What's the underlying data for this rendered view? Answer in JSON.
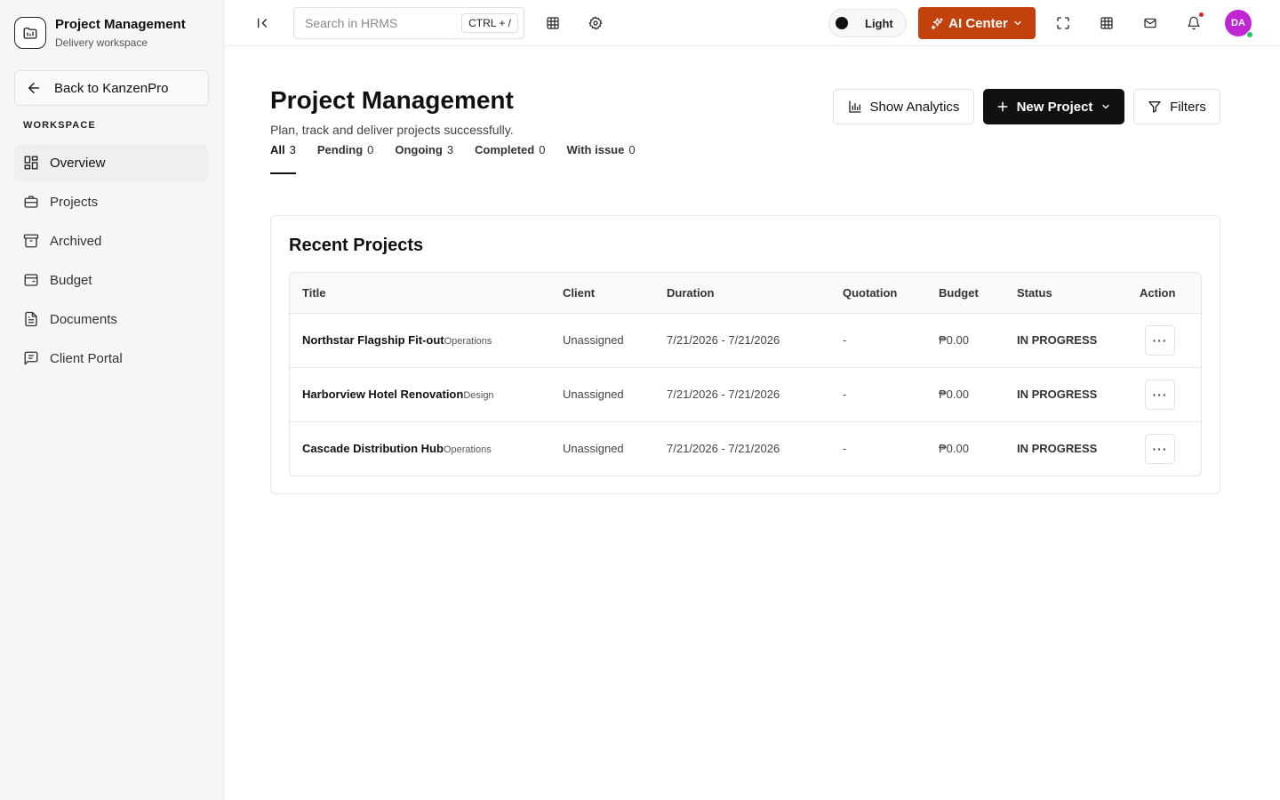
{
  "brand": {
    "title": "Project Management",
    "subtitle": "Delivery workspace"
  },
  "sidebar": {
    "back_label": "Back to KanzenPro",
    "section_label": "WORKSPACE",
    "items": [
      {
        "label": "Overview",
        "icon": "layout-dashboard-icon"
      },
      {
        "label": "Projects",
        "icon": "briefcase-icon"
      },
      {
        "label": "Archived",
        "icon": "archive-icon"
      },
      {
        "label": "Budget",
        "icon": "wallet-icon"
      },
      {
        "label": "Documents",
        "icon": "file-text-icon"
      },
      {
        "label": "Client Portal",
        "icon": "message-square-icon"
      }
    ]
  },
  "topbar": {
    "search_placeholder": "Search in HRMS",
    "search_shortcut": "CTRL + /",
    "theme_label": "Light",
    "ai_label": "AI Center",
    "avatar_initials": "DA"
  },
  "page": {
    "title": "Project Management",
    "subtitle": "Plan, track and deliver projects successfully.",
    "tabs": [
      {
        "label": "All",
        "count": "3"
      },
      {
        "label": "Pending",
        "count": "0"
      },
      {
        "label": "Ongoing",
        "count": "3"
      },
      {
        "label": "Completed",
        "count": "0"
      },
      {
        "label": "With issue",
        "count": "0"
      }
    ],
    "analytics_label": "Show Analytics",
    "new_project_label": "New Project",
    "filters_label": "Filters"
  },
  "recent": {
    "title": "Recent Projects",
    "columns": [
      "Title",
      "Client",
      "Duration",
      "Quotation",
      "Budget",
      "Status",
      "Action"
    ],
    "rows": [
      {
        "title": "Northstar Flagship Fit-out",
        "dept": "Operations",
        "client": "Unassigned",
        "duration": "7/21/2026 - 7/21/2026",
        "quotation": "-",
        "budget": "₱0.00",
        "status": "IN PROGRESS",
        "action": "···"
      },
      {
        "title": "Harborview Hotel Renovation",
        "dept": "Design",
        "client": "Unassigned",
        "duration": "7/21/2026 - 7/21/2026",
        "quotation": "-",
        "budget": "₱0.00",
        "status": "IN PROGRESS",
        "action": "···"
      },
      {
        "title": "Cascade Distribution Hub",
        "dept": "Operations",
        "client": "Unassigned",
        "duration": "7/21/2026 - 7/21/2026",
        "quotation": "-",
        "budget": "₱0.00",
        "status": "IN PROGRESS",
        "action": "···"
      }
    ]
  },
  "colors": {
    "accent": "#c2410c",
    "primary_button": "#111111",
    "avatar": "#c026d3",
    "notification_dot": "#dc2626",
    "online_dot": "#22c55e"
  }
}
